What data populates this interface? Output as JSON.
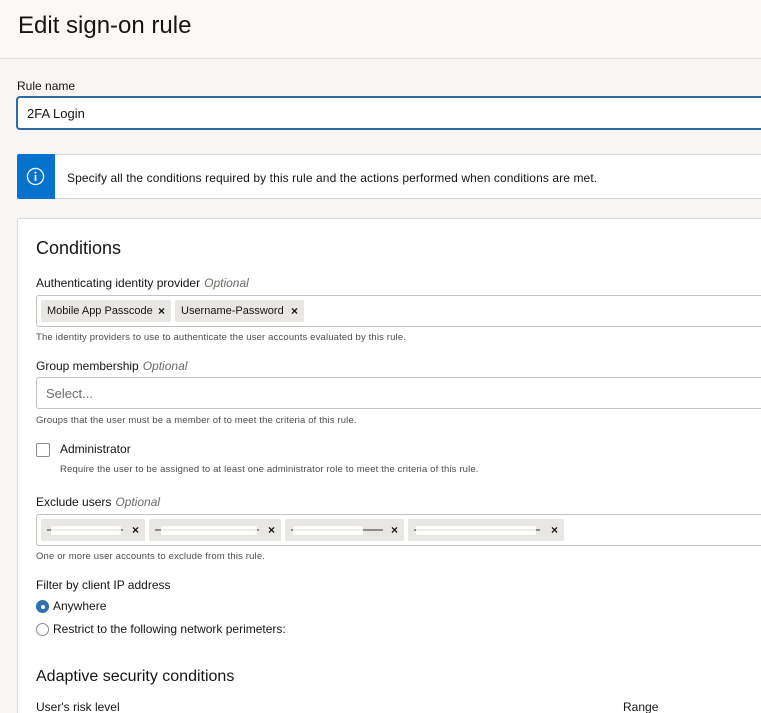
{
  "page": {
    "title": "Edit sign-on rule"
  },
  "rule_name": {
    "label": "Rule name",
    "value": "2FA Login"
  },
  "info_banner": {
    "text": "Specify all the conditions required by this rule and the actions performed when conditions are met.",
    "icon": "info-icon",
    "accent": "#0572ce"
  },
  "conditions": {
    "title": "Conditions",
    "identity_provider": {
      "label": "Authenticating identity provider",
      "optional": "Optional",
      "chips": [
        "Mobile App Passcode",
        "Username-Password"
      ],
      "help": "The identity providers to use to authenticate the user accounts evaluated by this rule."
    },
    "group_membership": {
      "label": "Group membership",
      "optional": "Optional",
      "placeholder": "Select...",
      "help": "Groups that the user must be a member of to meet the criteria of this rule."
    },
    "administrator": {
      "label": "Administrator",
      "checked": false,
      "help": "Require the user to be assigned to at least one administrator role to meet the criteria of this rule."
    },
    "exclude_users": {
      "label": "Exclude users",
      "optional": "Optional",
      "help": "One or more user accounts to exclude from this rule."
    },
    "client_ip": {
      "label": "Filter by client IP address",
      "options": [
        "Anywhere",
        "Restrict to the following network perimeters:"
      ],
      "selected": "Anywhere"
    }
  },
  "adaptive": {
    "title": "Adaptive security conditions",
    "risk_level_label": "User's risk level",
    "range_label": "Range"
  }
}
